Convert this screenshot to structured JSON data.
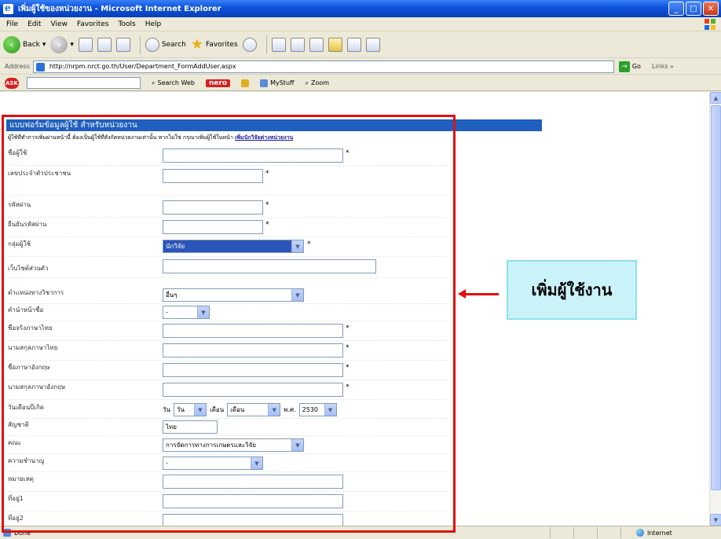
{
  "window": {
    "title": "เพิ่มผู้ใช้ของหน่วยงาน - Microsoft Internet Explorer",
    "controls": [
      "_",
      "□",
      "✕"
    ]
  },
  "menu": [
    "File",
    "Edit",
    "View",
    "Favorites",
    "Tools",
    "Help"
  ],
  "toolbar": {
    "back": "Back",
    "search": "Search",
    "favorites": "Favorites"
  },
  "address": {
    "label": "Address",
    "url": "http://nrpm.nrct.go.th/User/Department_FormAddUser.aspx",
    "go": "Go",
    "links": "Links »"
  },
  "searchbar": {
    "search_web": "Search Web",
    "nero": "nero",
    "mystuff": "MyStuff",
    "zoom": "Zoom"
  },
  "form": {
    "header": "แบบฟอร์มข้อมูลผู้ใช้ สำหรับหน่วยงาน",
    "note": "ผู้ใช้ที่ทำการเพิ่มผ่านหน้านี้ ต้องเป็นผู้ใช้ที่สังกัดหน่วยงานเท่านั้น หากไม่ใช่ กรุณาเพิ่มผู้ใช้ในหน้า",
    "note_link": "เพิ่มนักวิจัยต่างหน่วยงาน",
    "required_mark": "*",
    "fields": [
      {
        "label": "ชื่อผู้ใช้",
        "value": ""
      },
      {
        "label": "เลขประจำตัวประชาชน",
        "value": ""
      },
      {
        "label": "รหัสผ่าน",
        "value": ""
      },
      {
        "label": "ยืนยันรหัสผ่าน",
        "value": ""
      },
      {
        "label": "กลุ่มผู้ใช้",
        "value": "นักวิจัย"
      },
      {
        "label": "เว็บไซต์ส่วนตัว",
        "value": ""
      },
      {
        "label": "ตำแหน่งทางวิชาการ",
        "value": "อื่นๆ"
      },
      {
        "label": "คำนำหน้าชื่อ",
        "value": "-"
      },
      {
        "label": "ชื่อจริงภาษาไทย",
        "value": ""
      },
      {
        "label": "นามสกุลภาษาไทย",
        "value": ""
      },
      {
        "label": "ชื่อภาษาอังกฤษ",
        "value": ""
      },
      {
        "label": "นามสกุลภาษาอังกฤษ",
        "value": ""
      },
      {
        "label": "วันเดือนปีเกิด",
        "value": ""
      },
      {
        "label": "สัญชาติ",
        "value": "ไทย"
      },
      {
        "label": "คณะ",
        "value": "การจัดการทางการเกษตรและวิจัย"
      },
      {
        "label": "ความชำนาญ",
        "value": "-"
      },
      {
        "label": "หมายเหตุ",
        "value": ""
      },
      {
        "label": "ที่อยู่1",
        "value": ""
      },
      {
        "label": "ที่อยู่2",
        "value": ""
      }
    ],
    "dob": {
      "day_label": "วัน",
      "day": "วัน",
      "month_label": "เดือน",
      "month": "เดือน",
      "year_label": "พ.ศ.",
      "year": "2530"
    }
  },
  "annotation": {
    "callout": "เพิ่มผู้ใช้งาน",
    "box_color": "#e01010",
    "callout_bg": "#c9f3f8"
  },
  "status": {
    "left": "Done",
    "zone": "Internet"
  }
}
